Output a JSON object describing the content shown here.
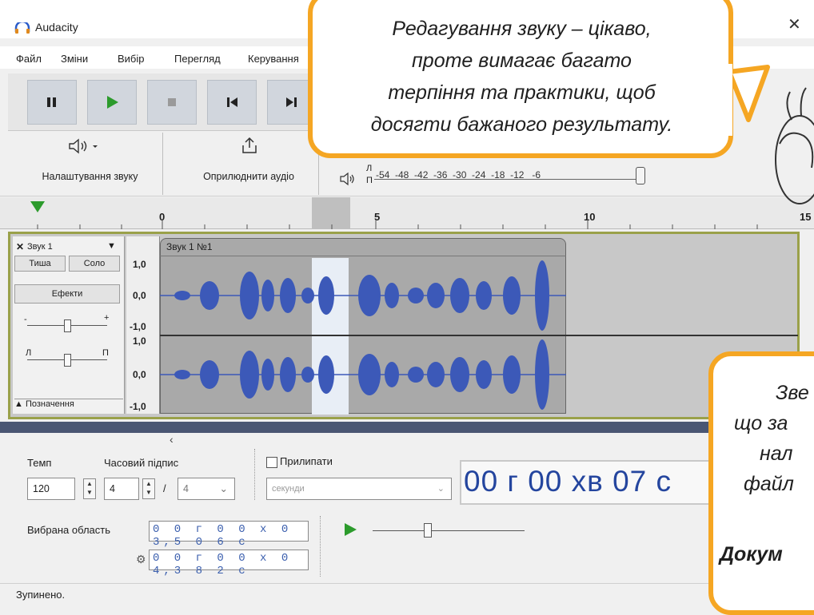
{
  "window": {
    "title": "Audacity",
    "restore_glyph": "☐",
    "close_glyph": "✕"
  },
  "menu": [
    "Файл",
    "Зміни",
    "Вибір",
    "Перегляд",
    "Керування"
  ],
  "transport": {
    "buttons": [
      "pause-icon",
      "play-icon",
      "stop-icon",
      "skip-start-icon",
      "skip-end-icon"
    ]
  },
  "toolbar2": {
    "audio_setup_label": "Налаштування звуку",
    "share_label": "Оприлюднити аудіо",
    "meter_scale": "-54  -48  -42  -36  -30  -24  -18  -12   -6",
    "meter_channels": [
      "Л",
      "П"
    ]
  },
  "ruler": {
    "labels": [
      "0",
      "5",
      "10",
      "15"
    ]
  },
  "track": {
    "name": "Звук 1",
    "clip_title": "Звук 1 №1",
    "mute_label": "Тиша",
    "solo_label": "Соло",
    "effects_label": "Ефекти",
    "pan_left": "Л",
    "pan_right": "П",
    "select_label": "Позначення",
    "scale": [
      "1,0",
      "0,0",
      "-1,0",
      "1,0",
      "0,0",
      "-1,0"
    ]
  },
  "bottom": {
    "tempo_label": "Темп",
    "tempo_value": "120",
    "timesig_label": "Часовий підпис",
    "timesig_num": "4",
    "timesig_sep": "/",
    "timesig_den": "4",
    "snap_label": "Прилипати",
    "snap_unit": "секунди",
    "big_time": "00 г 00 хв 07 с",
    "selection_label": "Вибрана область",
    "sel_start": "0 0 г 0 0 х 0 3,5 0 6 с",
    "sel_end": "0 0 г 0 0 х 0 4,3 8 2 с"
  },
  "status": {
    "text": "Зупинено."
  },
  "bubble1": {
    "lines": [
      "Редагування звуку – цікаво,",
      "проте вимагає багато",
      "терпіння та практики, щоб",
      "досягти бажаного результату."
    ]
  },
  "bubble2": {
    "lines": [
      "Зве",
      "що за",
      "нал",
      "файл",
      "Докум"
    ]
  },
  "colors": {
    "accent_orange": "#f5a623",
    "waveform": "#3c59b8",
    "play_green": "#2c9b2c",
    "time_blue": "#24459e"
  }
}
